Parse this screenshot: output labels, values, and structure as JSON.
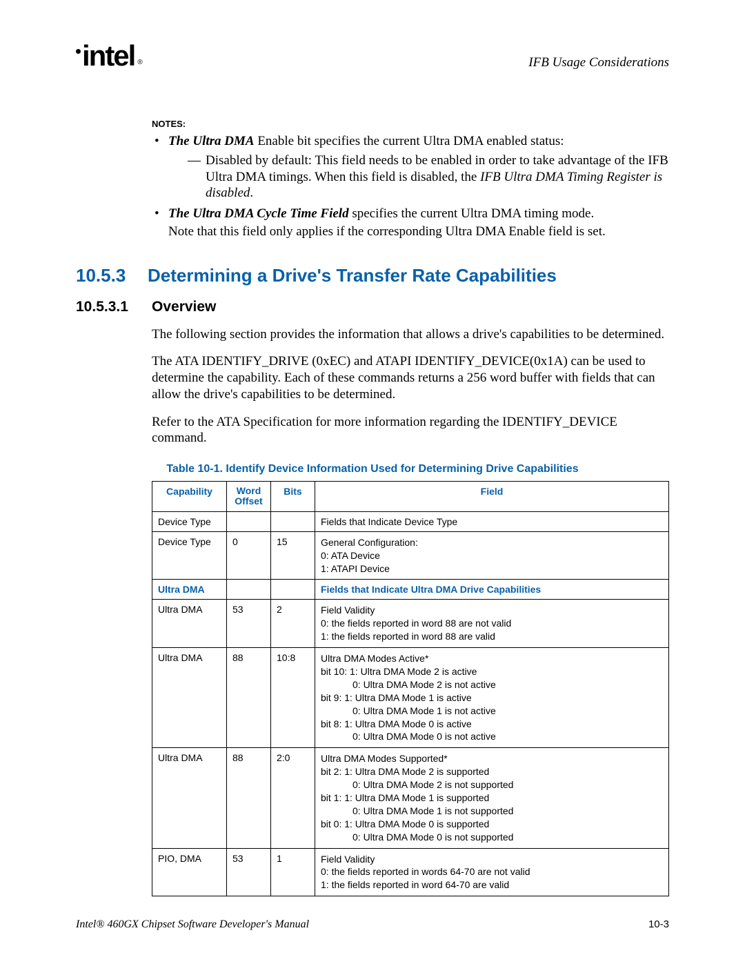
{
  "header": {
    "logo_text": "intel",
    "right": "IFB Usage Considerations"
  },
  "notes": {
    "label": "NOTES:",
    "bullets": [
      {
        "lead": "The Ultra DMA",
        "rest": " Enable bit specifies the current Ultra DMA enabled status:",
        "sub_prefix": "Disabled by default: This field needs to be enabled in order to take advantage of the IFB Ultra DMA timings. When this field is disabled, the ",
        "sub_italic": "IFB Ultra DMA Timing Register is disabled",
        "sub_suffix": "."
      },
      {
        "lead": "The Ultra DMA Cycle Time Field",
        "rest": " specifies the current Ultra DMA timing mode.",
        "note_line": "Note that this field only applies if the corresponding Ultra DMA Enable field is set."
      }
    ]
  },
  "section_h2": {
    "num": "10.5.3",
    "title": "Determining a Drive's Transfer Rate Capabilities"
  },
  "section_h3": {
    "num": "10.5.3.1",
    "title": "Overview"
  },
  "paras": {
    "p1": "The following section provides the information that allows a drive's capabilities to be determined.",
    "p2": "The ATA IDENTIFY_DRIVE (0xEC) and ATAPI IDENTIFY_DEVICE(0x1A) can be used to determine the capability. Each of these commands returns a 256 word buffer with fields that can allow the drive's capabilities to be determined.",
    "p3": "Refer to the ATA Specification for more information regarding the IDENTIFY_DEVICE command."
  },
  "table": {
    "caption": "Table 10-1. Identify Device Information Used for Determining Drive Capabilities",
    "headers": {
      "capability": "Capability",
      "word_offset": "Word Offset",
      "bits": "Bits",
      "field": "Field"
    },
    "rows": {
      "r0": {
        "cap": "Device Type",
        "word": "",
        "bits": "",
        "field": "Fields that Indicate Device Type"
      },
      "r1": {
        "cap": "Device Type",
        "word": "0",
        "bits": "15",
        "field": "General Configuration:\n0: ATA Device\n1: ATAPI Device"
      },
      "r2": {
        "cap": "Ultra DMA",
        "word": "",
        "bits": "",
        "field": "Fields that Indicate Ultra DMA Drive Capabilities"
      },
      "r3": {
        "cap": "Ultra DMA",
        "word": "53",
        "bits": "2",
        "field": "Field Validity\n0: the fields reported in word 88 are not valid\n1: the fields reported in word 88 are valid"
      },
      "r4": {
        "cap": "Ultra DMA",
        "word": "88",
        "bits": "10:8",
        "title": "Ultra DMA Modes Active*",
        "lines": [
          "bit 10: 1:  Ultra DMA Mode 2 is active",
          "0:  Ultra DMA Mode 2 is not active",
          "bit  9:  1:  Ultra DMA Mode 1 is active",
          "0:  Ultra DMA Mode 1 is not active",
          "bit  8:  1:  Ultra DMA Mode 0 is active",
          "0:  Ultra DMA Mode 0 is not active"
        ]
      },
      "r5": {
        "cap": "Ultra DMA",
        "word": "88",
        "bits": "2:0",
        "title": "Ultra DMA Modes Supported*",
        "lines": [
          "bit  2:  1:  Ultra DMA Mode 2 is supported",
          "0:  Ultra DMA Mode 2 is not supported",
          "bit  1:  1:  Ultra DMA Mode 1 is supported",
          "0:  Ultra DMA Mode 1 is not supported",
          "bit  0:  1:  Ultra DMA Mode 0 is supported",
          "0:  Ultra DMA Mode 0 is not supported"
        ]
      },
      "r6": {
        "cap": "PIO, DMA",
        "word": "53",
        "bits": "1",
        "field": "Field Validity\n0: the fields reported in words 64-70 are not valid\n1: the fields reported in word 64-70 are valid"
      }
    }
  },
  "footer": {
    "left": "Intel® 460GX Chipset Software Developer's Manual",
    "right": "10-3"
  }
}
